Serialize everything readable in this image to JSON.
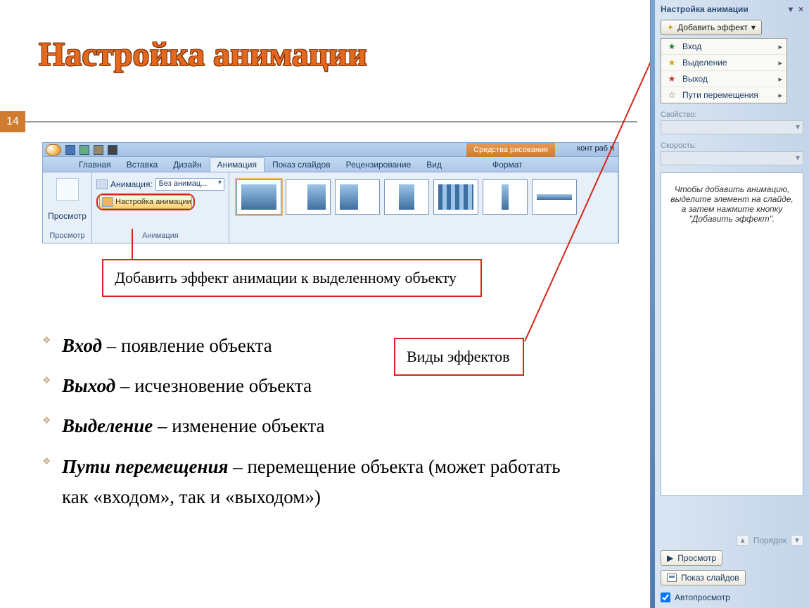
{
  "slide": {
    "title": "Настройка анимации",
    "number": "14"
  },
  "ribbon": {
    "tool_tab_label": "Средства рисования",
    "doc_title_frag": "конт раб п",
    "tabs": [
      "Главная",
      "Вставка",
      "Дизайн",
      "Анимация",
      "Показ слайдов",
      "Рецензирование",
      "Вид",
      "Формат"
    ],
    "active_tab_index": 3,
    "preview_label": "Просмотр",
    "group_preview": "Просмотр",
    "group_anim": "Анимация",
    "anim_row_label": "Анимация:",
    "anim_row_value": "Без анимац...",
    "settings_btn": "Настройка анимации"
  },
  "callouts": {
    "a": "Добавить эффект анимации к выделенному объекту",
    "b": "Виды эффектов"
  },
  "bullets": [
    {
      "term": "Вход",
      "desc": " – появление объекта"
    },
    {
      "term": "Выход",
      "desc": " – исчезновение объекта"
    },
    {
      "term": "Выделение",
      "desc": " – изменение объекта"
    },
    {
      "term": "Пути перемещения",
      "desc": " – перемещение объекта (может работать как «входом», так и «выходом»)"
    }
  ],
  "pane": {
    "title": "Настройка анимации",
    "add_effect": "Добавить эффект",
    "menu": [
      "Вход",
      "Выделение",
      "Выход",
      "Пути перемещения"
    ],
    "field_property": "Свойство:",
    "field_speed": "Скорость:",
    "hint": "Чтобы добавить анимацию, выделите элемент на слайде, а затем нажмите кнопку \"Добавить эффект\".",
    "order_label": "Порядок",
    "btn_preview": "Просмотр",
    "btn_slideshow": "Показ слайдов",
    "chk_autopreview": "Автопросмотр"
  }
}
